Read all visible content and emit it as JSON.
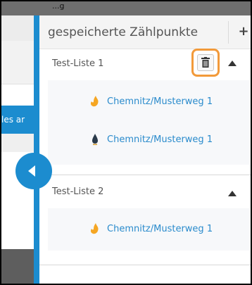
{
  "background": {
    "top_text": "...g",
    "blue_cell_text": "les ar"
  },
  "panel": {
    "title": "gespeicherte Zählpunkte",
    "add_label": "+"
  },
  "lists": [
    {
      "title": "Test-Liste 1",
      "items": [
        {
          "label": "Chemnitz/Musterweg 1",
          "icon": "flame-icon",
          "icon_color": "#f5a623"
        },
        {
          "label": "Chemnitz/Musterweg 1",
          "icon": "drop-icon",
          "icon_color": "#2a3a4a"
        }
      ]
    },
    {
      "title": "Test-Liste 2",
      "items": [
        {
          "label": "Chemnitz/Musterweg 1",
          "icon": "flame-icon",
          "icon_color": "#f5a623"
        }
      ]
    }
  ],
  "colors": {
    "accent": "#1c8ccf",
    "highlight": "#f29a3a",
    "link": "#2a8bcc"
  }
}
